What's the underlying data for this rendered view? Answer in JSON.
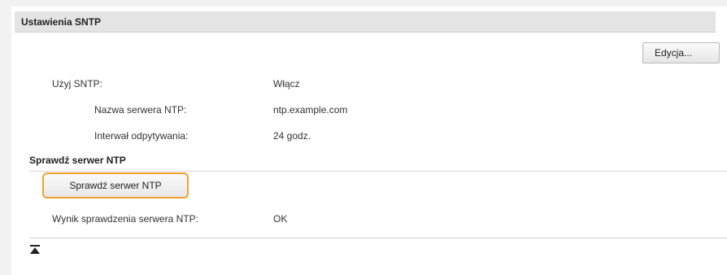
{
  "section": {
    "title": "Ustawienia SNTP",
    "edit_label": "Edycja..."
  },
  "settings": {
    "use_sntp_label": "Użyj SNTP:",
    "use_sntp_value": "Włącz",
    "server_name_label": "Nazwa serwera NTP:",
    "server_name_value": "ntp.example.com",
    "polling_label": "Interwał odpytywania:",
    "polling_value": "24 godz."
  },
  "check": {
    "header": "Sprawdź serwer NTP",
    "button_label": "Sprawdź serwer NTP",
    "result_label": "Wynik sprawdzenia serwera NTP:",
    "result_value": "OK"
  },
  "icons": {
    "back_to_top": "back-to-top-icon"
  },
  "colors": {
    "highlight": "#f0a030",
    "header_bg": "#e4e4e4"
  }
}
